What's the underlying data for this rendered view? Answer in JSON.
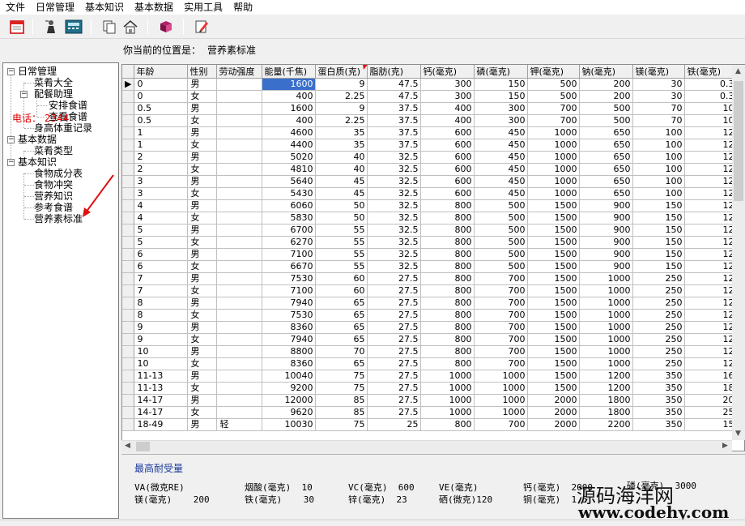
{
  "menu": [
    "文件",
    "日常管理",
    "基本知识",
    "基本数据",
    "实用工具",
    "帮助"
  ],
  "toolbar": {
    "icons": [
      "calendar-icon",
      "person-icon",
      "calculator-icon",
      "copy-icon",
      "home-icon",
      "book-icon",
      "edit-icon"
    ]
  },
  "location": {
    "label": "你当前的位置是：",
    "value": "营养素标准"
  },
  "tree": [
    {
      "label": "日常管理",
      "expander": "−"
    },
    {
      "label": "菜肴大全"
    },
    {
      "label": "配餐助理",
      "expander": "−"
    },
    {
      "label": "安排食谱"
    },
    {
      "label": "查看食谱"
    },
    {
      "label": "身高体重记录"
    },
    {
      "label": "基本数据",
      "expander": "−"
    },
    {
      "label": "菜肴类型"
    },
    {
      "label": "基本知识",
      "expander": "−"
    },
    {
      "label": "食物成分表"
    },
    {
      "label": "食物冲突"
    },
    {
      "label": "营养知识"
    },
    {
      "label": "参考食谱"
    },
    {
      "label": "营养素标准"
    }
  ],
  "phone": "电话：         2344",
  "grid": {
    "columns": [
      "年龄",
      "性别",
      "劳动强度",
      "能量(千焦)",
      "蛋白质(克)",
      "脂肪(克)",
      "钙(毫克)",
      "磷(毫克)",
      "钾(毫克)",
      "钠(毫克)",
      "镁(毫克)",
      "铁(毫克)"
    ],
    "rows": [
      [
        "0",
        "男",
        "",
        "1600",
        "9",
        "47.5",
        "300",
        "150",
        "500",
        "200",
        "30",
        "0.3"
      ],
      [
        "0",
        "女",
        "",
        "400",
        "2.25",
        "47.5",
        "300",
        "150",
        "500",
        "200",
        "30",
        "0.3"
      ],
      [
        "0.5",
        "男",
        "",
        "1600",
        "9",
        "37.5",
        "400",
        "300",
        "700",
        "500",
        "70",
        "10"
      ],
      [
        "0.5",
        "女",
        "",
        "400",
        "2.25",
        "37.5",
        "400",
        "300",
        "700",
        "500",
        "70",
        "10"
      ],
      [
        "1",
        "男",
        "",
        "4600",
        "35",
        "37.5",
        "600",
        "450",
        "1000",
        "650",
        "100",
        "12"
      ],
      [
        "1",
        "女",
        "",
        "4400",
        "35",
        "37.5",
        "600",
        "450",
        "1000",
        "650",
        "100",
        "12"
      ],
      [
        "2",
        "男",
        "",
        "5020",
        "40",
        "32.5",
        "600",
        "450",
        "1000",
        "650",
        "100",
        "12"
      ],
      [
        "2",
        "女",
        "",
        "4810",
        "40",
        "32.5",
        "600",
        "450",
        "1000",
        "650",
        "100",
        "12"
      ],
      [
        "3",
        "男",
        "",
        "5640",
        "45",
        "32.5",
        "600",
        "450",
        "1000",
        "650",
        "100",
        "12"
      ],
      [
        "3",
        "女",
        "",
        "5430",
        "45",
        "32.5",
        "600",
        "450",
        "1000",
        "650",
        "100",
        "12"
      ],
      [
        "4",
        "男",
        "",
        "6060",
        "50",
        "32.5",
        "800",
        "500",
        "1500",
        "900",
        "150",
        "12"
      ],
      [
        "4",
        "女",
        "",
        "5830",
        "50",
        "32.5",
        "800",
        "500",
        "1500",
        "900",
        "150",
        "12"
      ],
      [
        "5",
        "男",
        "",
        "6700",
        "55",
        "32.5",
        "800",
        "500",
        "1500",
        "900",
        "150",
        "12"
      ],
      [
        "5",
        "女",
        "",
        "6270",
        "55",
        "32.5",
        "800",
        "500",
        "1500",
        "900",
        "150",
        "12"
      ],
      [
        "6",
        "男",
        "",
        "7100",
        "55",
        "32.5",
        "800",
        "500",
        "1500",
        "900",
        "150",
        "12"
      ],
      [
        "6",
        "女",
        "",
        "6670",
        "55",
        "32.5",
        "800",
        "500",
        "1500",
        "900",
        "150",
        "12"
      ],
      [
        "7",
        "男",
        "",
        "7530",
        "60",
        "27.5",
        "800",
        "700",
        "1500",
        "1000",
        "250",
        "12"
      ],
      [
        "7",
        "女",
        "",
        "7100",
        "60",
        "27.5",
        "800",
        "700",
        "1500",
        "1000",
        "250",
        "12"
      ],
      [
        "8",
        "男",
        "",
        "7940",
        "65",
        "27.5",
        "800",
        "700",
        "1500",
        "1000",
        "250",
        "12"
      ],
      [
        "8",
        "女",
        "",
        "7530",
        "65",
        "27.5",
        "800",
        "700",
        "1500",
        "1000",
        "250",
        "12"
      ],
      [
        "9",
        "男",
        "",
        "8360",
        "65",
        "27.5",
        "800",
        "700",
        "1500",
        "1000",
        "250",
        "12"
      ],
      [
        "9",
        "女",
        "",
        "7940",
        "65",
        "27.5",
        "800",
        "700",
        "1500",
        "1000",
        "250",
        "12"
      ],
      [
        "10",
        "男",
        "",
        "8800",
        "70",
        "27.5",
        "800",
        "700",
        "1500",
        "1000",
        "250",
        "12"
      ],
      [
        "10",
        "女",
        "",
        "8360",
        "65",
        "27.5",
        "800",
        "700",
        "1500",
        "1000",
        "250",
        "12"
      ],
      [
        "11-13",
        "男",
        "",
        "10040",
        "75",
        "27.5",
        "1000",
        "1000",
        "1500",
        "1200",
        "350",
        "16"
      ],
      [
        "11-13",
        "女",
        "",
        "9200",
        "75",
        "27.5",
        "1000",
        "1000",
        "1500",
        "1200",
        "350",
        "18"
      ],
      [
        "14-17",
        "男",
        "",
        "12000",
        "85",
        "27.5",
        "1000",
        "1000",
        "2000",
        "1800",
        "350",
        "20"
      ],
      [
        "14-17",
        "女",
        "",
        "9620",
        "85",
        "27.5",
        "1000",
        "1000",
        "2000",
        "1800",
        "350",
        "25"
      ],
      [
        "18-49",
        "男",
        "轻",
        "10030",
        "75",
        "25",
        "800",
        "700",
        "2000",
        "2200",
        "350",
        "15"
      ]
    ]
  },
  "upper_limits": {
    "title": "最高耐受量",
    "fields": [
      {
        "label": "VA(微克RE)",
        "value": ""
      },
      {
        "label": "烟酸(毫克)",
        "value": "10"
      },
      {
        "label": "VC(毫克)",
        "value": "600"
      },
      {
        "label": "VE(毫克)",
        "value": ""
      },
      {
        "label": "钙(毫克)",
        "value": "2000"
      },
      {
        "label": "磷(毫克)",
        "value": "3000"
      },
      {
        "label": "镁(毫克)",
        "value": "200"
      },
      {
        "label": "铁(毫克)",
        "value": "30"
      },
      {
        "label": "锌(毫克)",
        "value": "23"
      },
      {
        "label": "硒(微克)",
        "value": "120"
      },
      {
        "label": "铜(毫克)",
        "value": "1.5"
      }
    ]
  },
  "watermark": {
    "line1": "源码海洋网",
    "line2": "www.codehy.com"
  }
}
